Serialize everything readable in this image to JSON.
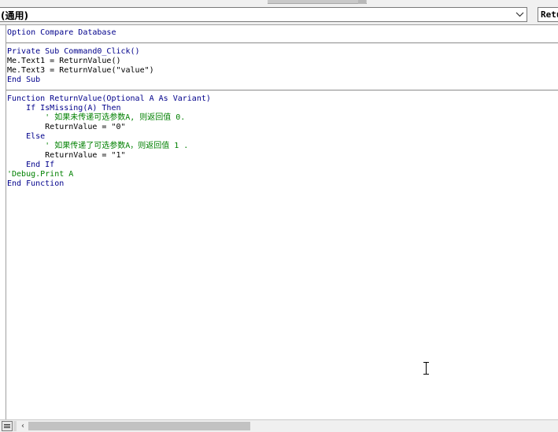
{
  "object_combo": {
    "value": "(通用)"
  },
  "procedure_combo": {
    "value": "ReturnValue"
  },
  "code": {
    "declarations": [
      "Option Compare Database"
    ],
    "sub": [
      "Private Sub Command0_Click()",
      "Me.Text1 = ReturnValue()",
      "Me.Text3 = ReturnValue(\"value\")",
      "End Sub"
    ],
    "function": [
      "Function ReturnValue(Optional A As Variant)",
      "    If IsMissing(A) Then",
      "        ' 如果未传递可选参数A, 则返回值 0.",
      "        ReturnValue = \"0\"",
      "    Else",
      "        ' 如果传递了可选参数A，则返回值 1 .",
      "        ReturnValue = \"1\"",
      "    End If",
      "'Debug.Print A",
      "End Function"
    ]
  },
  "icons": {
    "dropdown": "chevron-down-icon",
    "view_toggle": "procedure-view-icon",
    "scroll_left": "scroll-left-icon",
    "cursor": "text-cursor-icon"
  },
  "colors": {
    "keyword": "#00008b",
    "comment": "#008000",
    "text": "#000000",
    "background": "#ffffff"
  }
}
